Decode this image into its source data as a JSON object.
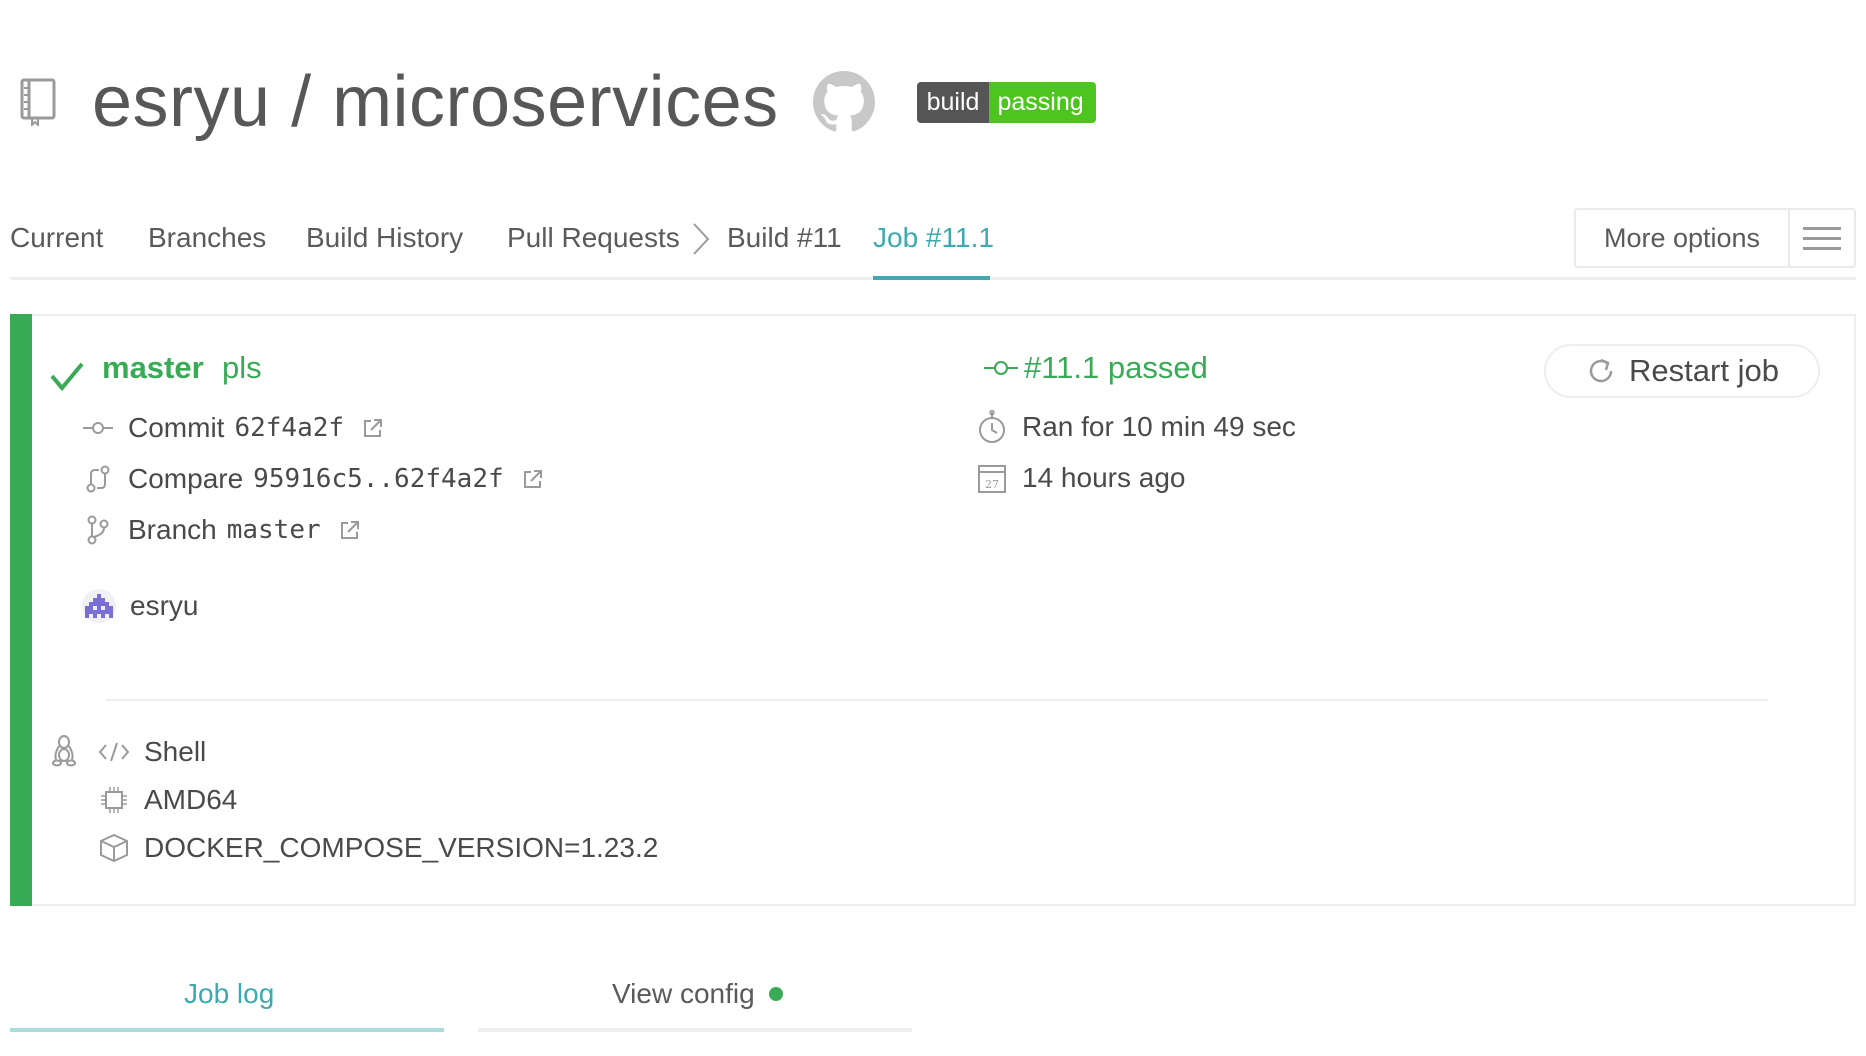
{
  "repo": {
    "owner": "esryu",
    "separator": "/",
    "name": "microservices",
    "title": "esryu / microservices",
    "badge": {
      "label": "build",
      "status": "passing",
      "label_color": "#555555",
      "status_color": "#4cc61e"
    }
  },
  "tabs": [
    {
      "label": "Current"
    },
    {
      "label": "Branches"
    },
    {
      "label": "Build History"
    },
    {
      "label": "Pull Requests"
    },
    {
      "label": "Build #11"
    },
    {
      "label": "Job #11.1",
      "active": true
    }
  ],
  "more_options": {
    "label": "More options"
  },
  "job": {
    "state_color": "#39aa56",
    "branch": "master",
    "commit_message": "pls",
    "status_text": "#11.1 passed",
    "restart_label": "Restart job",
    "commit": {
      "label": "Commit",
      "value": "62f4a2f"
    },
    "compare": {
      "label": "Compare",
      "value": "95916c5..62f4a2f"
    },
    "branch_link": {
      "label": "Branch",
      "value": "master"
    },
    "author": "esryu",
    "duration": "Ran for 10 min 49 sec",
    "finished": "14 hours ago",
    "calendar_day": "27",
    "language": "Shell",
    "arch": "AMD64",
    "env": "DOCKER_COMPOSE_VERSION=1.23.2"
  },
  "bottom_tabs": {
    "log": "Job log",
    "config": "View config"
  },
  "colors": {
    "accent_teal": "#3eaaaf",
    "success_green": "#39aa56"
  }
}
